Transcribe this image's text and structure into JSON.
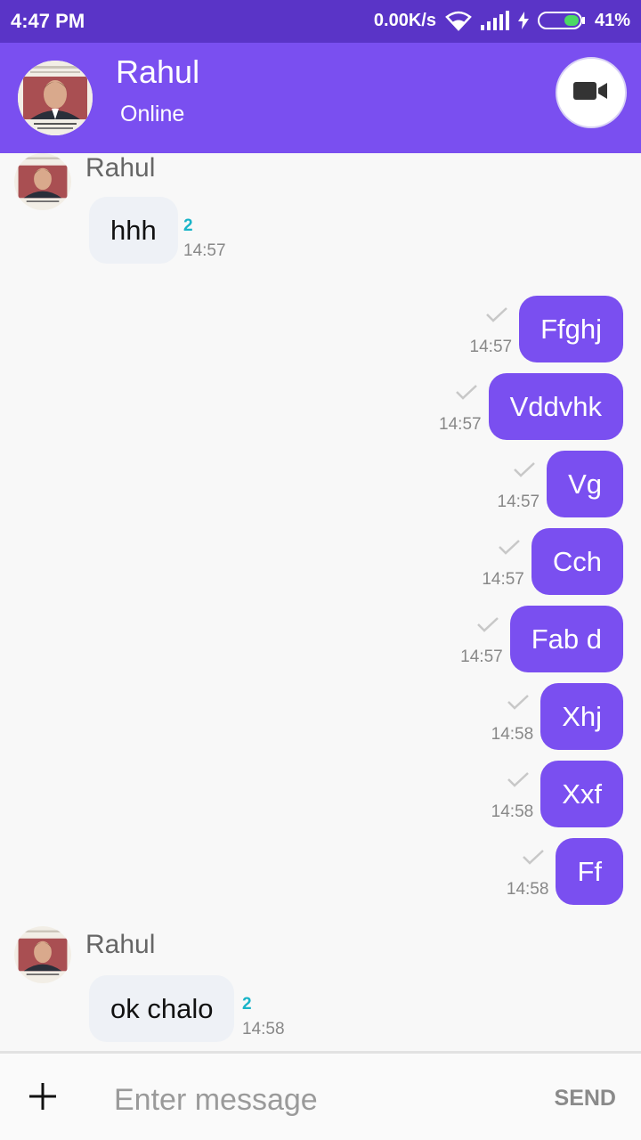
{
  "status_bar": {
    "time": "4:47 PM",
    "network_speed": "0.00K/s",
    "battery": "41%",
    "icons": [
      "wifi-icon",
      "signal-icon",
      "charging-icon",
      "battery-icon"
    ]
  },
  "header": {
    "contact_name": "Rahul",
    "presence": "Online",
    "video_icon": "video-camera-icon"
  },
  "colors": {
    "accent": "#7a4ff0",
    "status_bar": "#5a34c7",
    "incoming_bubble": "#eef1f6",
    "read_count": "#19b4c8"
  },
  "messages": {
    "incoming": [
      {
        "sender": "Rahul",
        "text": "hhh",
        "read_count": "2",
        "time": "14:57"
      },
      {
        "sender": "Rahul",
        "text": "ok chalo",
        "read_count": "2",
        "time": "14:58"
      }
    ],
    "outgoing": [
      {
        "text": "Ffghj",
        "time": "14:57"
      },
      {
        "text": "Vddvhk",
        "time": "14:57"
      },
      {
        "text": "Vg",
        "time": "14:57"
      },
      {
        "text": "Cch",
        "time": "14:57"
      },
      {
        "text": "Fab d",
        "time": "14:57"
      },
      {
        "text": "Xhj",
        "time": "14:58"
      },
      {
        "text": "Xxf",
        "time": "14:58"
      },
      {
        "text": "Ff",
        "time": "14:58"
      }
    ]
  },
  "composer": {
    "attach_icon": "plus-icon",
    "placeholder": "Enter message",
    "value": "",
    "send_label": "SEND"
  }
}
